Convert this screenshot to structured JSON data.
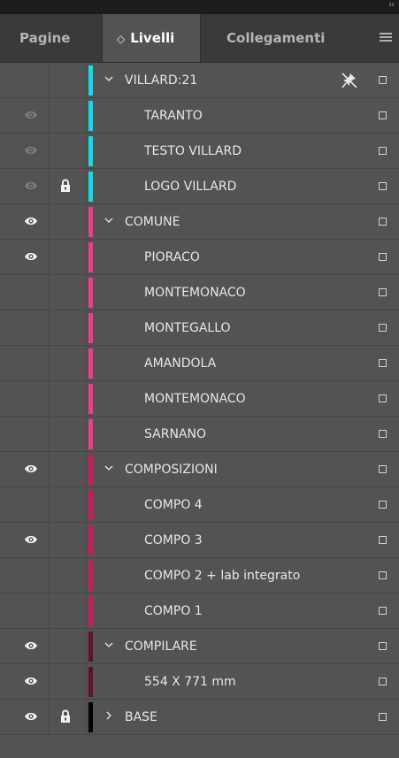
{
  "tabs": [
    {
      "label": "Pagine"
    },
    {
      "label": "Livelli",
      "arrow": "◇"
    },
    {
      "label": "Collegamenti"
    }
  ],
  "colors": {
    "cyan": "#1fd6e6",
    "pink": "#e8418a",
    "magenta": "#c81b5e",
    "maroon": "#5a1330",
    "black": "#000000"
  },
  "layers": [
    {
      "label": "VILLARD:21",
      "level": 0,
      "expanded": true,
      "color": "#1fd6e6",
      "eye": "none",
      "lock": false,
      "pin": true
    },
    {
      "label": "TARANTO",
      "level": 1,
      "color": "#1fd6e6",
      "eye": "dim",
      "lock": false
    },
    {
      "label": "TESTO VILLARD",
      "level": 1,
      "color": "#1fd6e6",
      "eye": "dim",
      "lock": false
    },
    {
      "label": "LOGO VILLARD",
      "level": 1,
      "color": "#1fd6e6",
      "eye": "dim",
      "lock": true
    },
    {
      "label": "COMUNE",
      "level": 0,
      "expanded": true,
      "color": "#e8418a",
      "eye": "on",
      "lock": false
    },
    {
      "label": "PIORACO",
      "level": 1,
      "color": "#e8418a",
      "eye": "on",
      "lock": false
    },
    {
      "label": "MONTEMONACO",
      "level": 1,
      "color": "#e8418a",
      "eye": "none",
      "lock": false
    },
    {
      "label": "MONTEGALLO",
      "level": 1,
      "color": "#e8418a",
      "eye": "none",
      "lock": false
    },
    {
      "label": "AMANDOLA",
      "level": 1,
      "color": "#e8418a",
      "eye": "none",
      "lock": false
    },
    {
      "label": "MONTEMONACO",
      "level": 1,
      "color": "#e8418a",
      "eye": "none",
      "lock": false
    },
    {
      "label": "SARNANO",
      "level": 1,
      "color": "#e8418a",
      "eye": "none",
      "lock": false
    },
    {
      "label": "COMPOSIZIONI",
      "level": 0,
      "expanded": true,
      "color": "#c81b5e",
      "eye": "on",
      "lock": false
    },
    {
      "label": "COMPO 4",
      "level": 1,
      "color": "#c81b5e",
      "eye": "none",
      "lock": false
    },
    {
      "label": "COMPO 3",
      "level": 1,
      "color": "#c81b5e",
      "eye": "on",
      "lock": false
    },
    {
      "label": "COMPO 2 + lab integrato",
      "level": 1,
      "color": "#c81b5e",
      "eye": "none",
      "lock": false
    },
    {
      "label": "COMPO 1",
      "level": 1,
      "color": "#c81b5e",
      "eye": "none",
      "lock": false
    },
    {
      "label": "COMPILARE",
      "level": 0,
      "expanded": true,
      "color": "#5a1330",
      "eye": "on",
      "lock": false
    },
    {
      "label": "554 X 771 mm",
      "level": 1,
      "color": "#5a1330",
      "eye": "on",
      "lock": false
    },
    {
      "label": "BASE",
      "level": 0,
      "expanded": false,
      "color": "#000000",
      "eye": "on",
      "lock": true
    }
  ]
}
